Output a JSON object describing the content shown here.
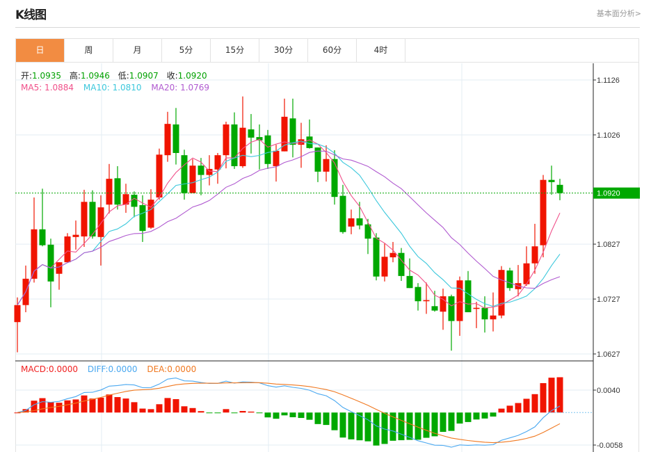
{
  "header": {
    "title": "K线图",
    "link": "基本面分析>"
  },
  "tabs": [
    {
      "label": "日",
      "active": true
    },
    {
      "label": "周"
    },
    {
      "label": "月"
    },
    {
      "label": "5分"
    },
    {
      "label": "15分"
    },
    {
      "label": "30分"
    },
    {
      "label": "60分"
    },
    {
      "label": "4时"
    }
  ],
  "ohlc_info": {
    "open_label": "开:",
    "open": "1.0935",
    "high_label": "高:",
    "high": "1.0946",
    "low_label": "低:",
    "low": "1.0907",
    "close_label": "收:",
    "close": "1.0920"
  },
  "ma_info": {
    "ma5": "MA5: 1.0884",
    "ma10": "MA10: 1.0810",
    "ma20": "MA20: 1.0769"
  },
  "macd_info": {
    "macd": "MACD:0.0000",
    "diff": "DIFF:0.0000",
    "dea": "DEA:0.0000"
  },
  "colors": {
    "up": "#f01400",
    "down": "#00a800",
    "ma5": "#f0508a",
    "ma10": "#3cc8dc",
    "ma20": "#b05ad0",
    "diff": "#4aa8f0",
    "dea": "#f07820",
    "active_tab": "#f28c42"
  },
  "chart_data": {
    "type": "candlestick",
    "price_axis": {
      "ticks": [
        "1.1126",
        "1.1026",
        "1.0827",
        "1.0727",
        "1.0627"
      ],
      "range": [
        1.0627,
        1.1126
      ],
      "current": "1.0920"
    },
    "macd_axis": {
      "ticks": [
        "0.0040",
        "-0.0058"
      ],
      "range": [
        -0.0058,
        0.004
      ]
    },
    "candles": [
      [
        1.0685,
        1.073,
        1.063,
        1.0716
      ],
      [
        1.0716,
        1.0788,
        1.0703,
        1.0764
      ],
      [
        1.0764,
        1.0912,
        1.0757,
        1.0854
      ],
      [
        1.0854,
        1.0928,
        1.0823,
        1.0825
      ],
      [
        1.0826,
        1.0837,
        1.0712,
        1.0759
      ],
      [
        1.0773,
        1.0794,
        1.0744,
        1.0794
      ],
      [
        1.0794,
        1.0847,
        1.0794,
        1.0841
      ],
      [
        1.084,
        1.087,
        1.0817,
        1.0844
      ],
      [
        1.0841,
        1.0926,
        1.0822,
        1.0904
      ],
      [
        1.0904,
        1.0925,
        1.0837,
        1.0841
      ],
      [
        1.084,
        1.0916,
        1.0788,
        1.0894
      ],
      [
        1.0899,
        1.0973,
        1.0883,
        1.0946
      ],
      [
        1.0947,
        1.0969,
        1.089,
        1.0899
      ],
      [
        1.0899,
        1.0937,
        1.0884,
        1.0918
      ],
      [
        1.0917,
        1.0923,
        1.0876,
        1.0895
      ],
      [
        1.0898,
        1.0916,
        1.0831,
        1.0851
      ],
      [
        1.0857,
        1.0927,
        1.0855,
        1.0908
      ],
      [
        1.0912,
        1.1001,
        1.0908,
        1.099
      ],
      [
        1.0989,
        1.1068,
        1.0977,
        1.1046
      ],
      [
        1.1045,
        1.1075,
        1.0972,
        1.0993
      ],
      [
        1.0989,
        1.0999,
        1.0908,
        1.092
      ],
      [
        1.092,
        1.0982,
        1.092,
        1.097
      ],
      [
        1.097,
        1.0984,
        1.0916,
        1.0953
      ],
      [
        1.0953,
        1.0989,
        1.0934,
        1.0964
      ],
      [
        1.0963,
        1.0993,
        1.0937,
        1.0989
      ],
      [
        1.0989,
        1.105,
        1.0965,
        1.1045
      ],
      [
        1.1045,
        1.1067,
        1.0964,
        1.0969
      ],
      [
        1.0969,
        1.1096,
        1.0966,
        1.1039
      ],
      [
        1.1036,
        1.1064,
        1.0992,
        1.1021
      ],
      [
        1.1022,
        1.1045,
        1.0963,
        1.1016
      ],
      [
        1.1025,
        1.1035,
        1.0964,
        1.0973
      ],
      [
        1.0969,
        1.1008,
        1.0941,
        1.0997
      ],
      [
        1.0996,
        1.1092,
        1.0996,
        1.1059
      ],
      [
        1.1056,
        1.1092,
        1.0985,
        1.1008
      ],
      [
        1.1008,
        1.1048,
        1.0966,
        1.1018
      ],
      [
        1.1023,
        1.1054,
        1.1001,
        1.1002
      ],
      [
        1.1003,
        1.1003,
        1.094,
        1.0959
      ],
      [
        1.0959,
        1.1007,
        1.0941,
        1.0982
      ],
      [
        1.0982,
        1.0998,
        1.0899,
        1.0913
      ],
      [
        1.0915,
        1.0935,
        1.0846,
        1.0849
      ],
      [
        1.0859,
        1.089,
        1.0845,
        1.0874
      ],
      [
        1.0874,
        1.0904,
        1.0854,
        1.0861
      ],
      [
        1.0863,
        1.0873,
        1.0809,
        1.0837
      ],
      [
        1.0839,
        1.0847,
        1.0761,
        1.0768
      ],
      [
        1.0768,
        1.0828,
        1.0759,
        1.0804
      ],
      [
        1.0803,
        1.0831,
        1.0794,
        1.0811
      ],
      [
        1.0811,
        1.082,
        1.076,
        1.0769
      ],
      [
        1.0769,
        1.0801,
        1.0747,
        1.0747
      ],
      [
        1.0749,
        1.0756,
        1.0706,
        1.0723
      ],
      [
        1.0723,
        1.0757,
        1.07,
        1.0725
      ],
      [
        1.0714,
        1.0742,
        1.0704,
        1.0706
      ],
      [
        1.0704,
        1.0746,
        1.0671,
        1.0732
      ],
      [
        1.0732,
        1.0735,
        1.0633,
        1.0687
      ],
      [
        1.0687,
        1.0768,
        1.066,
        1.0761
      ],
      [
        1.0761,
        1.0778,
        1.0703,
        1.0703
      ],
      [
        1.0709,
        1.0722,
        1.0674,
        1.0711
      ],
      [
        1.0711,
        1.0732,
        1.0666,
        1.069
      ],
      [
        1.069,
        1.0739,
        1.0668,
        1.0697
      ],
      [
        1.0697,
        1.0787,
        1.0692,
        1.078
      ],
      [
        1.0779,
        1.0784,
        1.0742,
        1.0747
      ],
      [
        1.0745,
        1.0789,
        1.0732,
        1.0756
      ],
      [
        1.0754,
        1.0823,
        1.0751,
        1.0792
      ],
      [
        1.0792,
        1.0864,
        1.0773,
        1.0823
      ],
      [
        1.0825,
        1.0953,
        1.0803,
        1.0944
      ],
      [
        1.0944,
        1.097,
        1.0917,
        1.094
      ],
      [
        1.0935,
        1.0946,
        1.0907,
        1.092
      ]
    ]
  }
}
